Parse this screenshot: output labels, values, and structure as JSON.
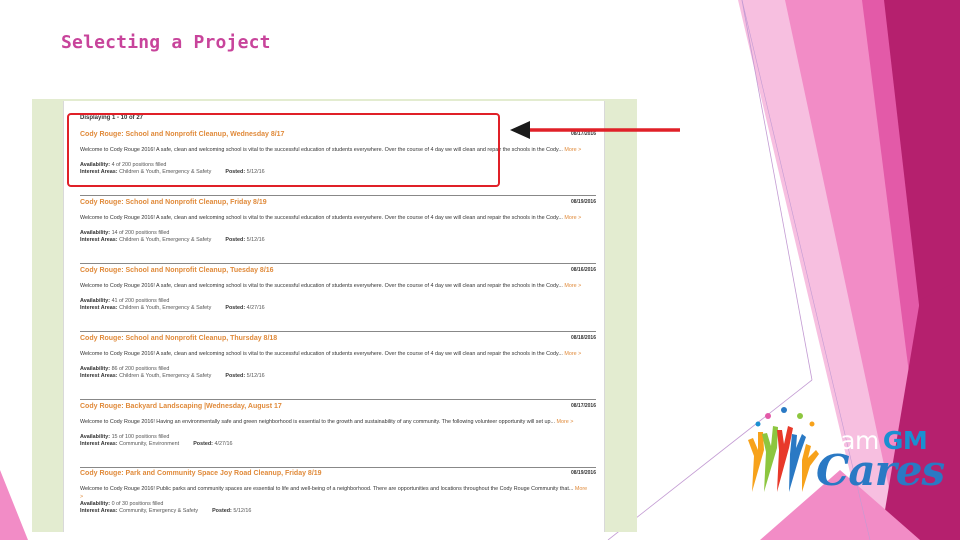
{
  "slide": {
    "title": "Selecting a Project"
  },
  "colors": {
    "title": "#c8449b",
    "listing_title": "#e08a3a",
    "highlight": "#e02028",
    "frame": "#e3ecd0",
    "deco_pink_dark": "#b5206e",
    "deco_pink_mid": "#e35aa8",
    "deco_pink_light": "#f7bfe0"
  },
  "listings_header": "Displaying 1 - 10 of 27",
  "labels": {
    "more": "More >",
    "availability": "Availability:",
    "interest_areas": "Interest Areas:",
    "posted": "Posted:"
  },
  "listings": [
    {
      "title": "Cody Rouge: School and Nonprofit Cleanup, Wednesday 8/17",
      "date": "08/17/2016",
      "description": "Welcome to Cody Rouge 2016! A safe, clean and welcoming school is vital to the successful education of students everywhere. Over the course of 4 day we will clean and repair the schools in the Cody...",
      "availability": "4 of 200 positions filled",
      "interest_areas": "Children & Youth, Emergency & Safety",
      "posted": "5/12/16"
    },
    {
      "title": "Cody Rouge: School and Nonprofit Cleanup, Friday 8/19",
      "date": "08/19/2016",
      "description": "Welcome to Cody Rouge 2016! A safe, clean and welcoming school is vital to the successful education of students everywhere. Over the course of 4 day we will clean and repair the schools in the Cody...",
      "availability": "14 of 200 positions filled",
      "interest_areas": "Children & Youth, Emergency & Safety",
      "posted": "5/12/16"
    },
    {
      "title": "Cody Rouge: School and Nonprofit Cleanup, Tuesday 8/16",
      "date": "08/16/2016",
      "description": "Welcome to Cody Rouge 2016! A safe, clean and welcoming school is vital to the successful education of students everywhere. Over the course of 4 day we will clean and repair the schools in the Cody...",
      "availability": "41 of 200 positions filled",
      "interest_areas": "Children & Youth, Emergency & Safety",
      "posted": "4/27/16"
    },
    {
      "title": "Cody Rouge: School and Nonprofit Cleanup, Thursday 8/18",
      "date": "08/18/2016",
      "description": "Welcome to Cody Rouge 2016! A safe, clean and welcoming school is vital to the successful education of students everywhere. Over the course of 4 day we will clean and repair the schools in the Cody...",
      "availability": "86 of 200 positions filled",
      "interest_areas": "Children & Youth, Emergency & Safety",
      "posted": "5/12/16"
    },
    {
      "title": "Cody Rouge: Backyard Landscaping |Wednesday, August 17",
      "date": "08/17/2016",
      "description": "Welcome to Cody Rouge 2016! Having an environmentally safe and green neighborhood is essential to the growth and sustainability of any community. The following volunteer opportunity will set up...",
      "availability": "15 of 100 positions filled",
      "interest_areas": "Community, Environment",
      "posted": "4/27/16"
    },
    {
      "title": "Cody Rouge: Park and Community Space Joy Road Cleanup, Friday 8/19",
      "date": "08/19/2016",
      "description": "Welcome to Cody Rouge 2016! Public parks and community spaces are essential to life and well-being of a neighborhood. There are opportunities and locations throughout the Cody Rouge Community that...",
      "availability": "0 of 30 positions filled",
      "interest_areas": "Community, Emergency & Safety",
      "posted": "5/12/16"
    }
  ],
  "logo": {
    "team": "team",
    "gm": "GM",
    "cares": "Cares"
  }
}
